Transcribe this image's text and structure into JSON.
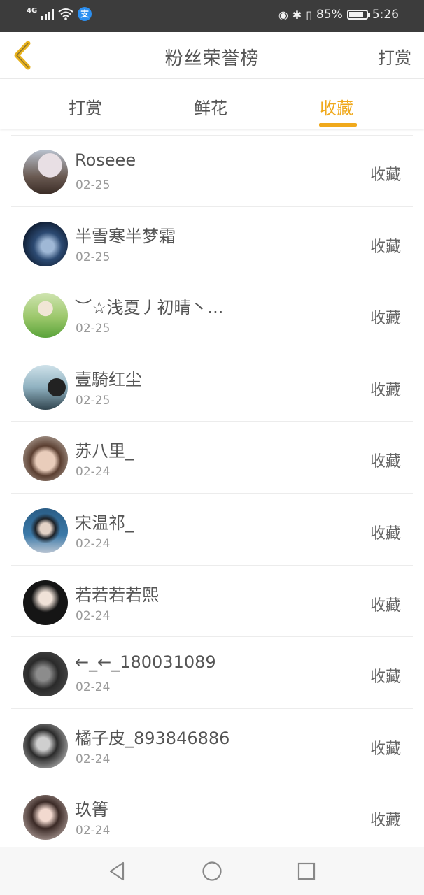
{
  "status_bar": {
    "network": "4G",
    "alipay_badge": "支",
    "battery": "85%",
    "battery_level": 0.85,
    "time": "5:26"
  },
  "header": {
    "title": "粉丝荣誉榜",
    "action": "打赏",
    "back_icon": "chevron-left-icon"
  },
  "tabs": [
    {
      "label": "打赏",
      "active": false
    },
    {
      "label": "鲜花",
      "active": false
    },
    {
      "label": "收藏",
      "active": true
    }
  ],
  "accent_color": "#f0a91c",
  "fans": [
    {
      "name": "Roseee",
      "date": "02-25",
      "type": "收藏"
    },
    {
      "name": "半雪寒半梦霜",
      "date": "02-25",
      "type": "收藏"
    },
    {
      "name": "︶☆浅夏丿初晴丶...",
      "date": "02-25",
      "type": "收藏"
    },
    {
      "name": "壹騎红尘",
      "date": "02-25",
      "type": "收藏"
    },
    {
      "name": "苏八里_",
      "date": "02-24",
      "type": "收藏"
    },
    {
      "name": "宋温祁_",
      "date": "02-24",
      "type": "收藏"
    },
    {
      "name": "若若若若熙",
      "date": "02-24",
      "type": "收藏"
    },
    {
      "name": "←_←_180031089",
      "date": "02-24",
      "type": "收藏"
    },
    {
      "name": "橘子皮_893846886",
      "date": "02-24",
      "type": "收藏"
    },
    {
      "name": "玖箐",
      "date": "02-24",
      "type": "收藏"
    }
  ],
  "nav": [
    "back-triangle-icon",
    "home-circle-icon",
    "recents-square-icon"
  ]
}
